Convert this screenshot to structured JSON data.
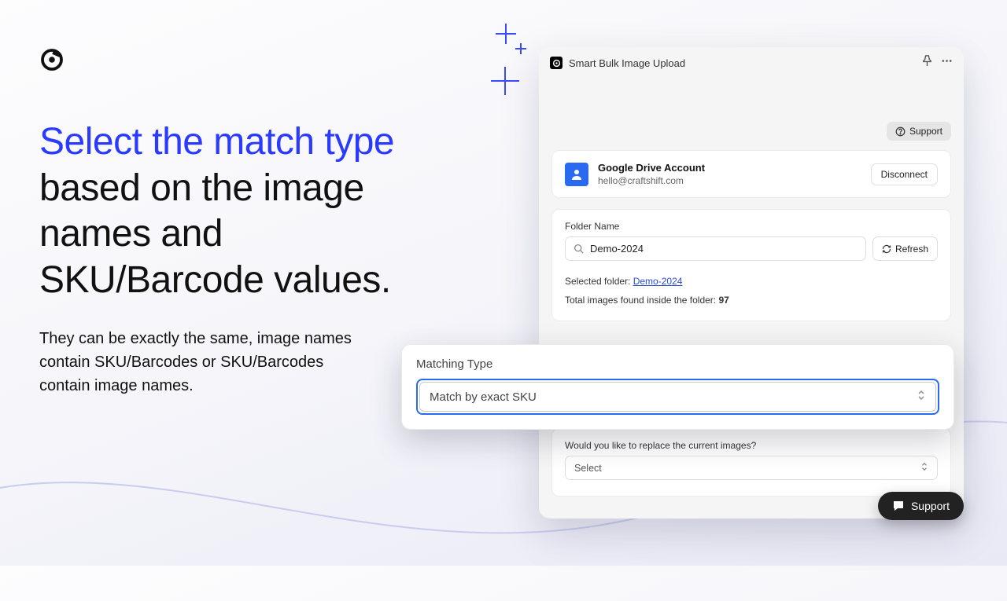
{
  "headline": {
    "blue": "Select the match type",
    "rest": " based on the image names and SKU/Barcode values."
  },
  "subtext": "They can be exactly the same, image names contain SKU/Barcodes or SKU/Barcodes contain image names.",
  "panel": {
    "title": "Smart Bulk Image Upload",
    "support_label": "Support",
    "account": {
      "title": "Google Drive Account",
      "email": "hello@craftshift.com",
      "disconnect_label": "Disconnect"
    },
    "folder": {
      "label": "Folder Name",
      "value": "Demo-2024",
      "refresh_label": "Refresh",
      "selected_prefix": "Selected folder: ",
      "selected_link": "Demo-2024",
      "total_prefix": "Total images found inside the folder: ",
      "total_count": "97"
    },
    "match": {
      "label": "Matching Type",
      "value": "Match by exact SKU"
    },
    "replace": {
      "label": "Would you like to replace the current images?",
      "value": "Select"
    }
  },
  "float_support": "Support"
}
